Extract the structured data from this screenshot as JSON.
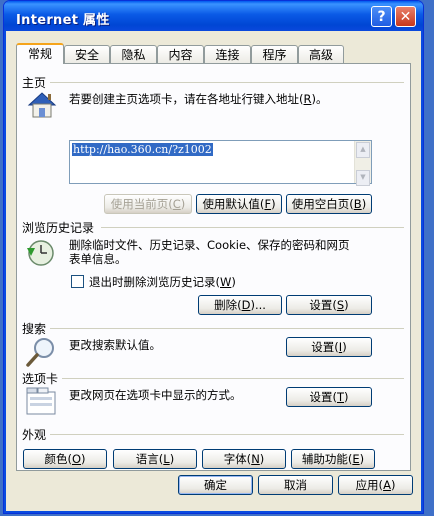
{
  "window": {
    "title": "Internet 属性",
    "help_glyph": "?",
    "close_glyph": "✕"
  },
  "tabs": [
    {
      "label": "常规"
    },
    {
      "label": "安全"
    },
    {
      "label": "隐私"
    },
    {
      "label": "内容"
    },
    {
      "label": "连接"
    },
    {
      "label": "程序"
    },
    {
      "label": "高级"
    }
  ],
  "homepage": {
    "title": "主页",
    "description_pre": "若要创建主页选项卡，请在各地址行键入地址(",
    "description_key": "R",
    "description_post": ")。",
    "url": "http://hao.360.cn/?z1002",
    "btn_current_pre": "使用当前页(",
    "btn_current_key": "C",
    "btn_default_pre": "使用默认值(",
    "btn_default_key": "F",
    "btn_blank_pre": "使用空白页(",
    "btn_blank_key": "B",
    "close_paren": ")"
  },
  "history": {
    "title": "浏览历史记录",
    "line1": "删除临时文件、历史记录、Cookie、保存的密码和网页",
    "line2": "表单信息。",
    "checkbox_pre": "退出时删除浏览历史记录(",
    "checkbox_key": "W",
    "checkbox_post": ")",
    "delete_pre": "删除(",
    "delete_key": "D",
    "delete_post": ")...",
    "settings_pre": "设置(",
    "settings_key": "S",
    "settings_post": ")"
  },
  "search": {
    "title": "搜索",
    "description": "更改搜索默认值。",
    "settings_pre": "设置(",
    "settings_key": "I",
    "settings_post": ")"
  },
  "tabsection": {
    "title": "选项卡",
    "description": "更改网页在选项卡中显示的方式。",
    "settings_pre": "设置(",
    "settings_key": "T",
    "settings_post": ")"
  },
  "appearance": {
    "title": "外观",
    "colors_pre": "颜色(",
    "colors_key": "O",
    "language_pre": "语言(",
    "language_key": "L",
    "fonts_pre": "字体(",
    "fonts_key": "N",
    "access_pre": "辅助功能(",
    "access_key": "E",
    "close_paren": ")"
  },
  "footer": {
    "ok": "确定",
    "cancel": "取消",
    "apply_pre": "应用(",
    "apply_key": "A",
    "apply_post": ")"
  }
}
